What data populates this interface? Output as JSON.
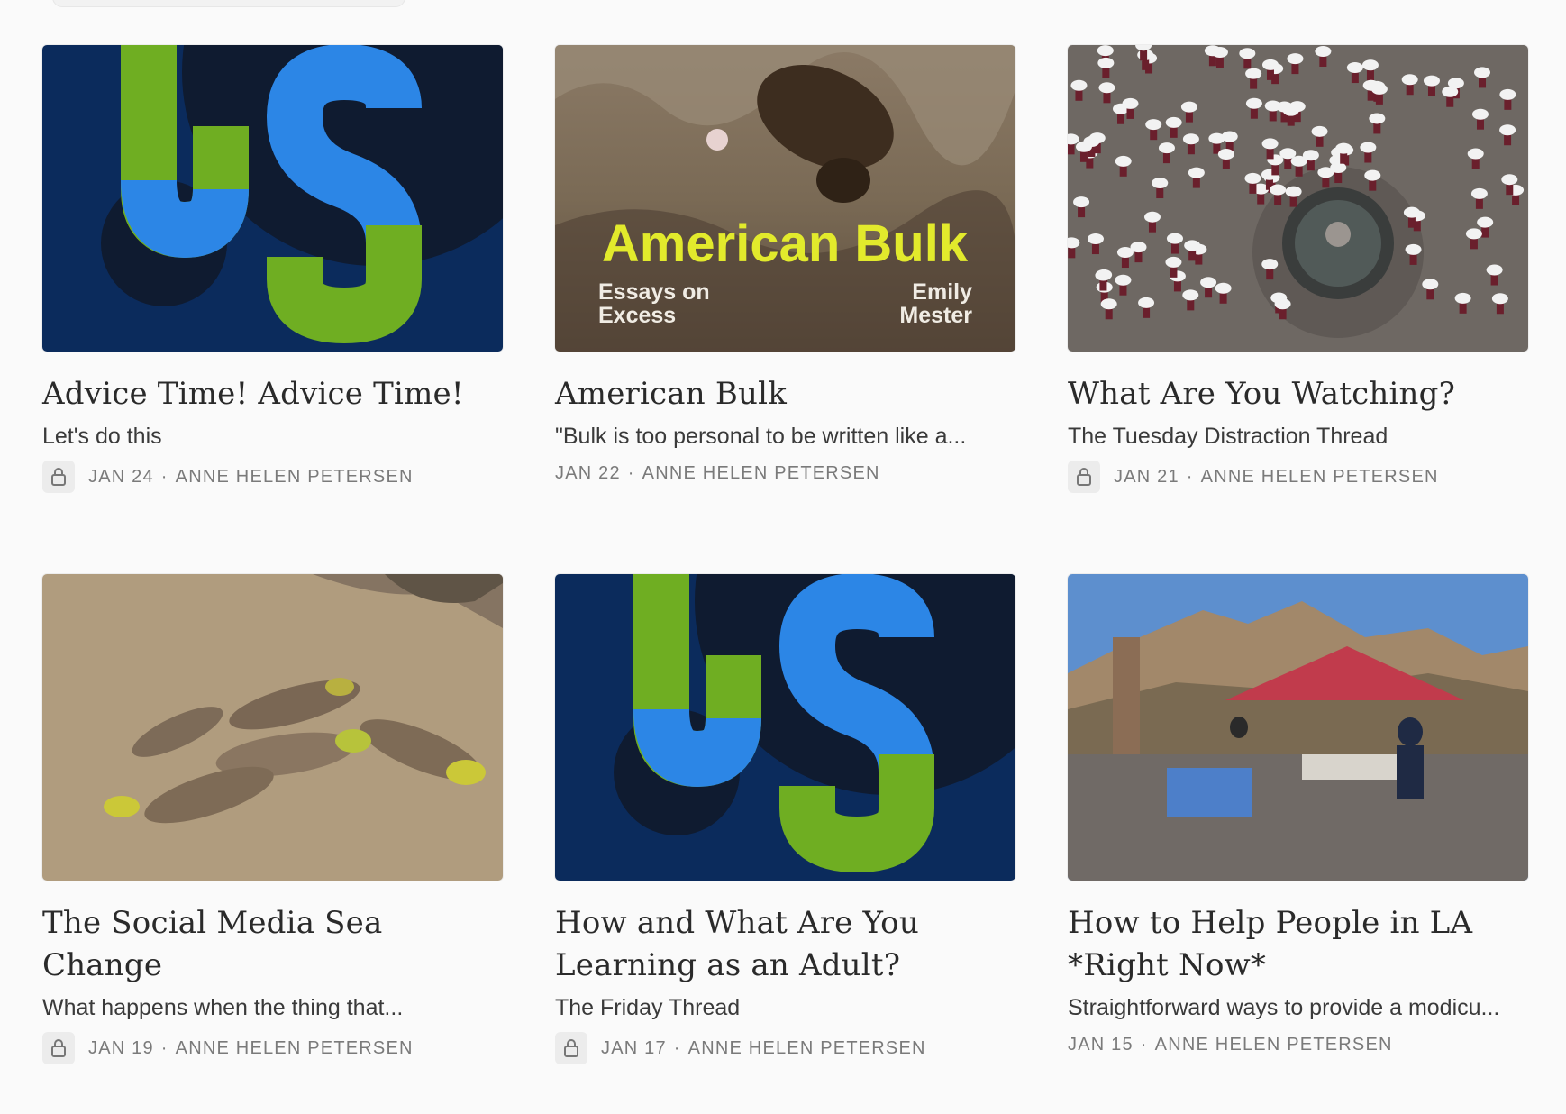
{
  "posts": [
    {
      "title": "Advice Time! Advice Time!",
      "subtitle": "Let's do this",
      "date": "JAN 24",
      "author": "ANNE HELEN PETERSEN",
      "locked": true,
      "image": "culture-study-logo"
    },
    {
      "title": "American Bulk",
      "subtitle": "\"Bulk is too personal to be written like a...",
      "date": "JAN 22",
      "author": "ANNE HELEN PETERSEN",
      "locked": false,
      "image": "american-bulk-cover",
      "cover": {
        "title": "American Bulk",
        "left_line1": "Essays on",
        "left_line2": "Excess",
        "right_line1": "Emily",
        "right_line2": "Mester"
      }
    },
    {
      "title": "What Are You Watching?",
      "subtitle": "The Tuesday Distraction Thread",
      "date": "JAN 21",
      "author": "ANNE HELEN PETERSEN",
      "locked": true,
      "image": "umbrella-fountain-photo"
    },
    {
      "title": "The Social Media Sea Change",
      "subtitle": "What happens when the thing that...",
      "date": "JAN 19",
      "author": "ANNE HELEN PETERSEN",
      "locked": true,
      "image": "sunken-boats-photo"
    },
    {
      "title": "How and What Are You Learning as an Adult?",
      "subtitle": "The Friday Thread",
      "date": "JAN 17",
      "author": "ANNE HELEN PETERSEN",
      "locked": true,
      "image": "culture-study-logo"
    },
    {
      "title": "How to Help People in LA *Right Now*",
      "subtitle": "Straightforward ways to provide a modicu...",
      "date": "JAN 15",
      "author": "ANNE HELEN PETERSEN",
      "locked": false,
      "image": "la-relief-tent-photo"
    }
  ],
  "meta_separator": "·",
  "colors": {
    "logo_navy": "#0b2b5c",
    "logo_dark": "#0f1b30",
    "logo_green": "#6fae22",
    "logo_blue": "#2c86e6",
    "cover_yellow": "#e2ea2c"
  }
}
